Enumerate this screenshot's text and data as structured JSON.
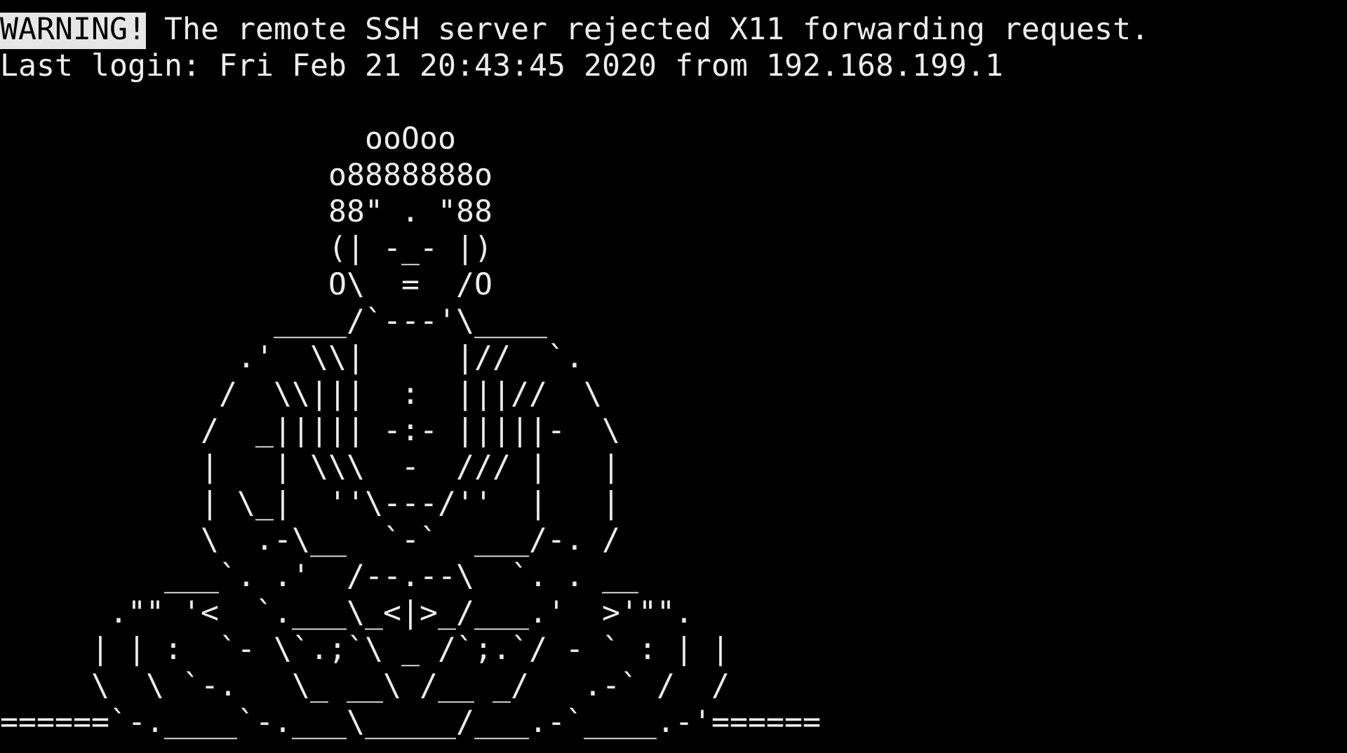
{
  "terminal": {
    "messages": [
      {
        "kind": "warning",
        "label": "WARNING!",
        "text": "The remote SSH server rejected X11 forwarding request."
      },
      {
        "kind": "plain",
        "text": "Last login: Fri Feb 21 20:43:45 2020 from 192.168.199.1"
      }
    ],
    "ascii_art": [
      "                    ooOoo",
      "                  o8888888o",
      "                  88\" . \"88",
      "                  (| -_- |)",
      "                  O\\  =  /O",
      "               ____/`---'\\____",
      "             .'  \\\\|     |//  `.",
      "            /  \\\\|||  :  |||//  \\",
      "           /  _||||| -:- |||||-  \\",
      "           |   | \\\\\\  -  /// |   |",
      "           | \\_|  ''\\---/''  |   |",
      "           \\  .-\\__  `-`  ___/-. /",
      "         ___`. .'  /--.--\\  `. . __",
      "      .\"\" '<  `.___\\_<|>_/___.'  >'\"\".",
      "     | | :  `- \\`.;`\\ _ /`;.`/ - ` : | |",
      "     \\  \\ `-.   \\_ __\\ /__ _/   .-` /  /",
      "======`-.____`-.___\\_____/___.-`____.-'======"
    ]
  }
}
